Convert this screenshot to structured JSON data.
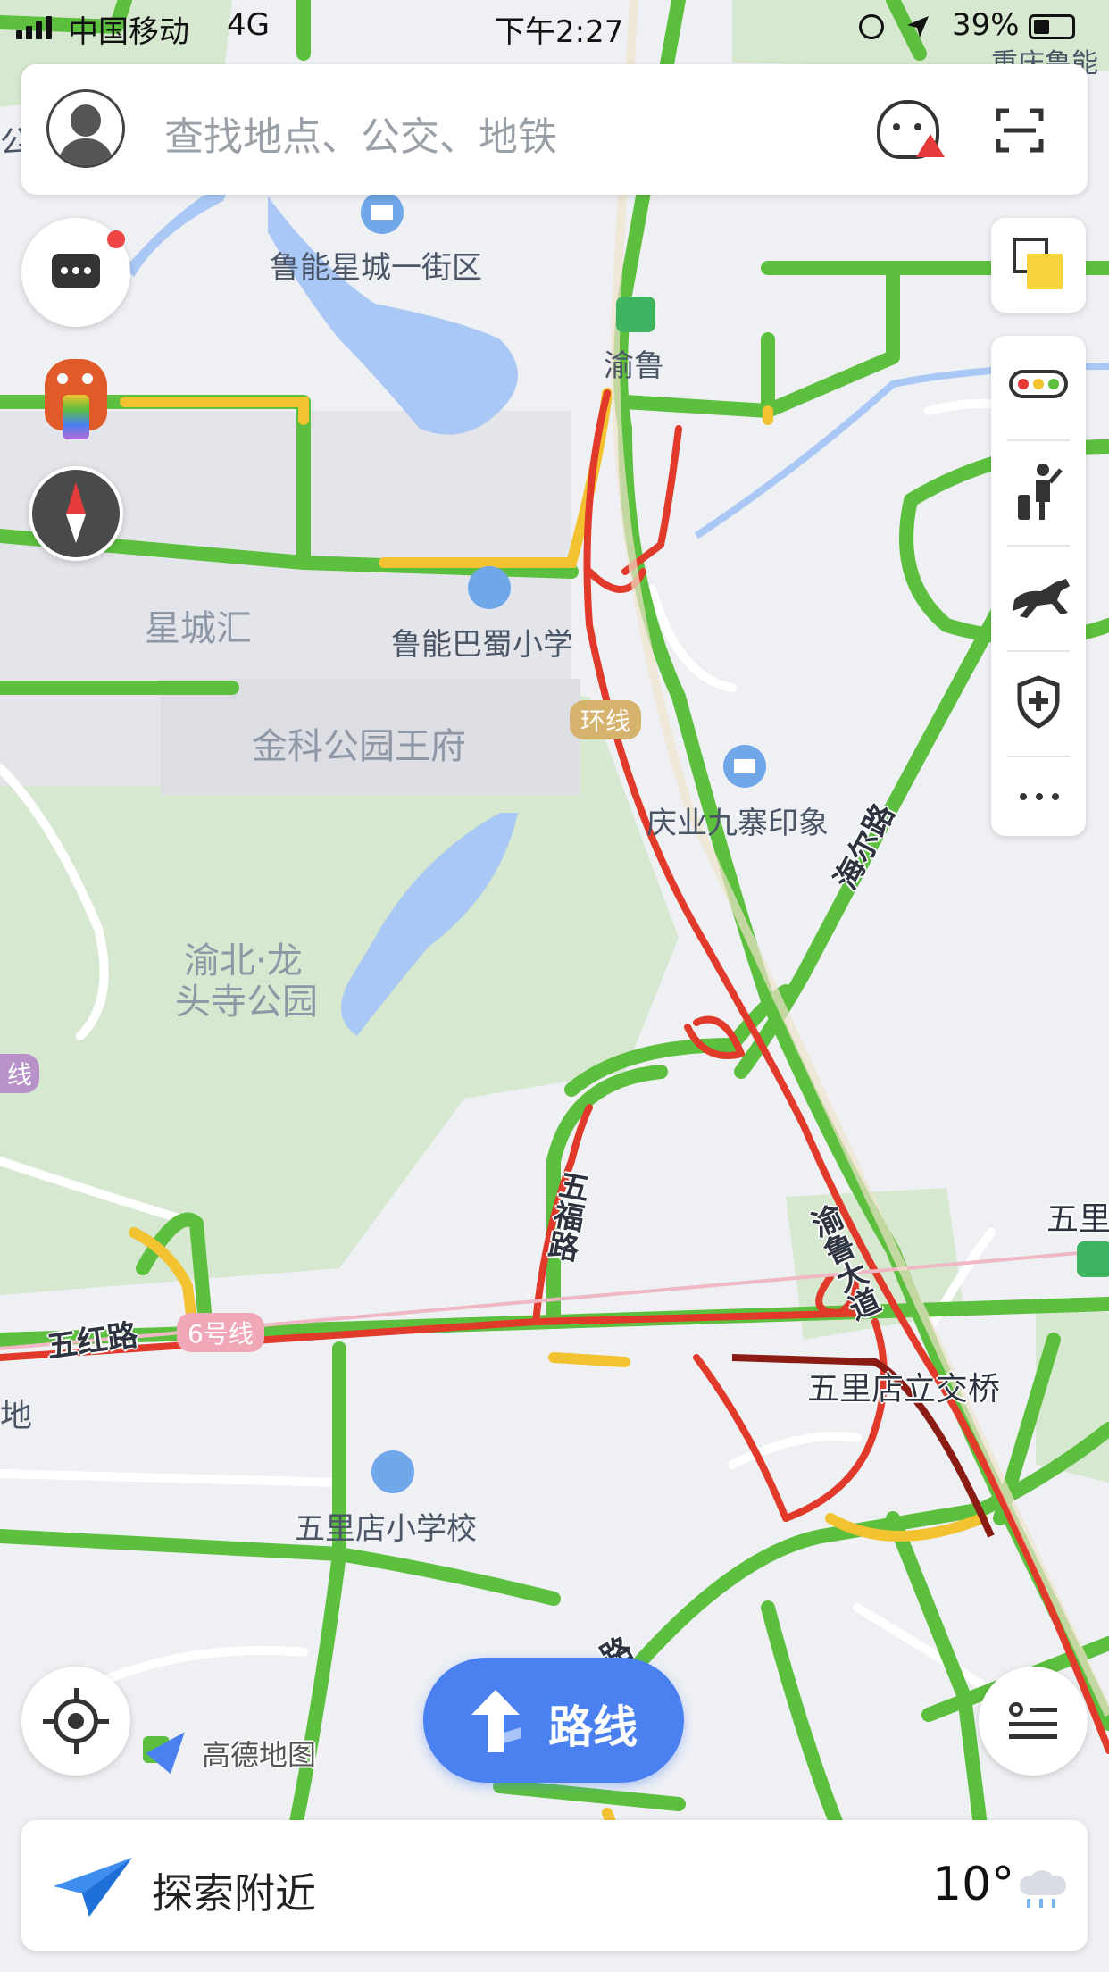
{
  "status_bar": {
    "carrier": "中国移动",
    "network": "4G",
    "time": "下午2:27",
    "battery": "39%"
  },
  "search": {
    "placeholder": "查找地点、公交、地铁"
  },
  "map": {
    "corner_label": "重庆鲁能",
    "pois": {
      "poi_1": "鲁能星城一街区",
      "poi_2": "渝鲁",
      "poi_3": "鲁能巴蜀小学",
      "poi_4": "庆业九寨印象",
      "poi_5": "五里店小学校",
      "poi_6": "五里店立交桥"
    },
    "areas": {
      "area_1": "星城汇",
      "area_2": "金科公园王府",
      "area_3_line1": "渝北·龙",
      "area_3_line2": "头寺公园"
    },
    "roads": {
      "ring_badge": "环线",
      "line6_badge": "6号线",
      "haier": "海尔路",
      "wufu": "五福路",
      "wuhong": "五红路",
      "yulu": "渝鲁大道",
      "wuli_edge": "五里",
      "edge_left_1": "线",
      "edge_left_2": "地",
      "edge_bottom": "路",
      "edge_top_left": "公"
    },
    "colors": {
      "smooth": "#5cbf3e",
      "slow": "#f2c230",
      "congested": "#e13a2a",
      "severe": "#8b1c14",
      "park": "#d6e8cf",
      "water": "#a9c8f5"
    }
  },
  "controls": {
    "brand": "高德地图",
    "route_button": "路线",
    "explore": "探索附近",
    "temperature": "10°",
    "layer_panel_icons": [
      "traffic-icon",
      "elevator-icon",
      "horse-icon",
      "shield-icon",
      "more-icon"
    ]
  }
}
